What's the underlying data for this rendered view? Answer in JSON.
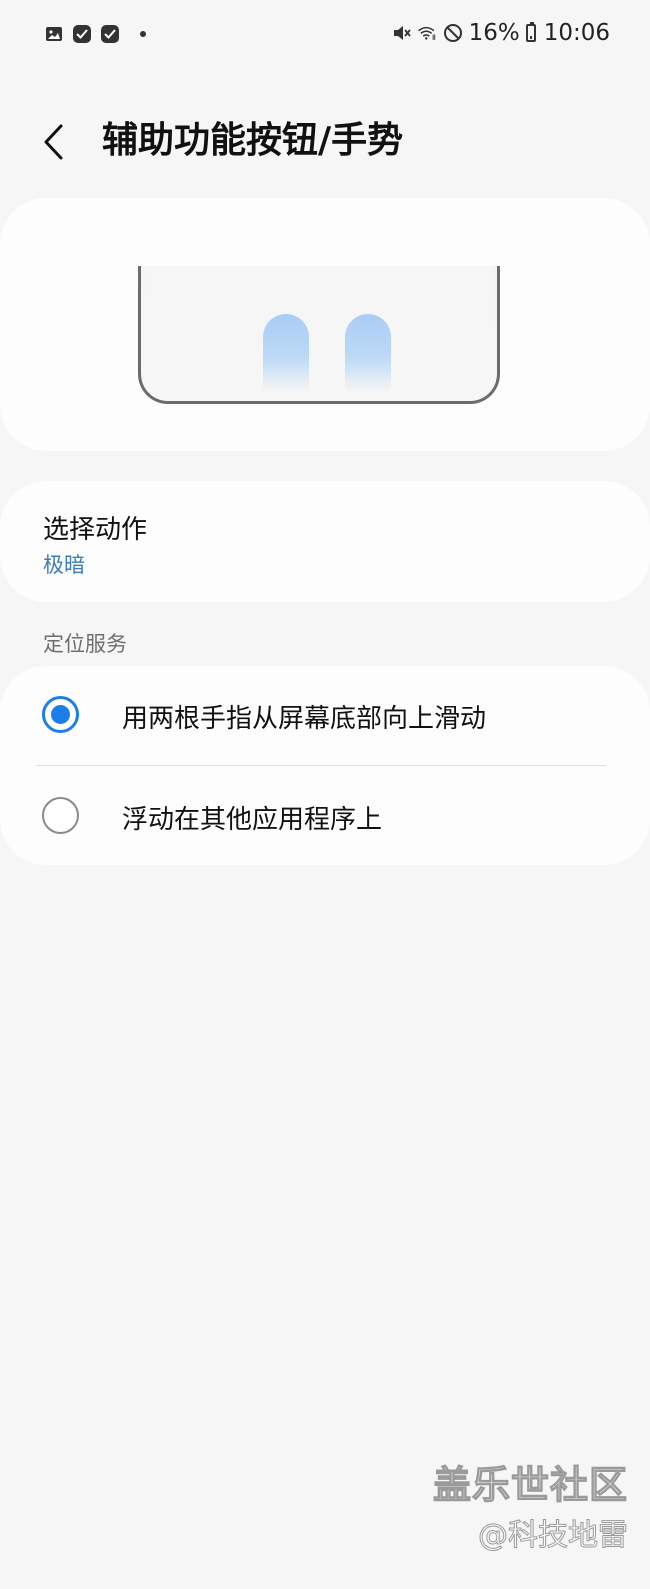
{
  "status_bar": {
    "left_icons": [
      "gallery-icon",
      "check-app-icon",
      "check-app-icon-2",
      "notification-dot"
    ],
    "right_icons": [
      "mute-icon",
      "wifi-icon",
      "do-not-disturb-icon"
    ],
    "battery": "16%",
    "time": "10:06"
  },
  "header": {
    "title": "辅助功能按钮/手势"
  },
  "action": {
    "title": "选择动作",
    "value": "极暗"
  },
  "section": {
    "title": "定位服务"
  },
  "options": [
    {
      "label": "用两根手指从屏幕底部向上滑动",
      "selected": true
    },
    {
      "label": "浮动在其他应用程序上",
      "selected": false
    }
  ],
  "watermark": {
    "line1": "盖乐世社区",
    "line2": "@科技地雷"
  },
  "colors": {
    "accent": "#1a7fe8",
    "link": "#3a7db8",
    "background": "#f6f6f6",
    "card": "#fdfdfd"
  }
}
